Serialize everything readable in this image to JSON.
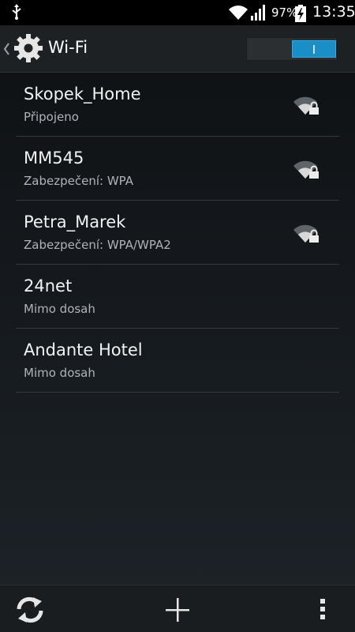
{
  "status_bar": {
    "battery_percent": "97%",
    "time": "13:35",
    "icons": [
      "usb-icon",
      "wifi-status-icon",
      "cell-signal-icon",
      "battery-charging-icon"
    ]
  },
  "action_bar": {
    "title": "Wi-Fi",
    "toggle_label": "I",
    "toggle_state": "on",
    "accent_color": "#1a8fc7"
  },
  "networks": [
    {
      "name": "Skopek_Home",
      "status": "Připojeno",
      "secured": true
    },
    {
      "name": "MM545",
      "status": "Zabezpečení: WPA",
      "secured": true
    },
    {
      "name": "Petra_Marek",
      "status": "Zabezpečení: WPA/WPA2",
      "secured": true
    },
    {
      "name": "24net",
      "status": "Mimo dosah",
      "secured": false
    },
    {
      "name": "Andante Hotel",
      "status": "Mimo dosah",
      "secured": false
    }
  ],
  "bottom_bar": {
    "icons": [
      "scan-icon",
      "add-network-icon",
      "overflow-menu-icon"
    ]
  }
}
